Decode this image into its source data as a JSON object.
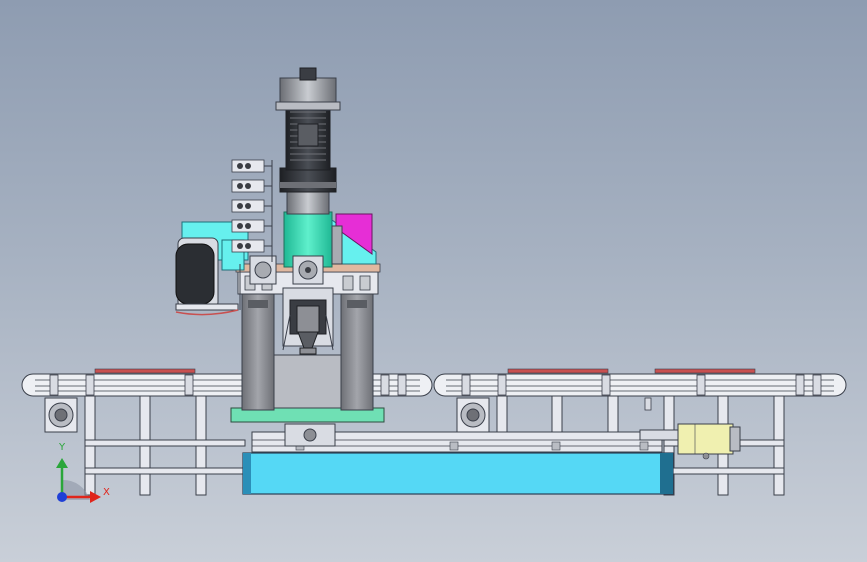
{
  "viewport": {
    "background_top": "#8e9cb1",
    "background_bottom": "#c9cfd8"
  },
  "triad": {
    "x_label": "X",
    "y_label": "Y",
    "x_color": "#e0251b",
    "y_color": "#2aa63a",
    "z_color": "#1f3fd6"
  },
  "colors": {
    "frame_steel": "#e6e8ee",
    "frame_outline": "#3a3f4a",
    "column_gray": "#8d8f95",
    "bed_cyan": "#55d8f5",
    "head_teal": "#33e0b8",
    "guard_cyan": "#66f0ee",
    "box_magenta": "#e62ed6",
    "motor_dark": "#2b2e33",
    "gear_gray": "#a8abb1",
    "base_green": "#6fe0b4",
    "cylinder_yellow": "#f0f0b0",
    "belt_red": "#c85050"
  }
}
